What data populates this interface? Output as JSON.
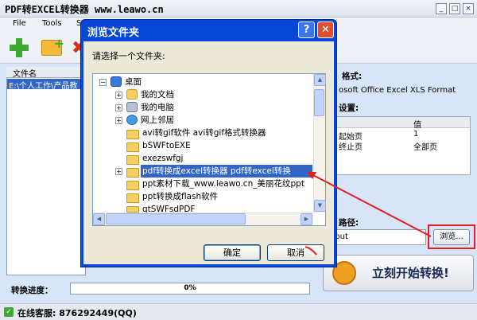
{
  "app": {
    "title": "PDF转EXCEL转换器 www.leawo.cn",
    "menu": [
      "File",
      "Tools",
      "S"
    ]
  },
  "file_list": {
    "column_header": "文件名",
    "rows": [
      "E:\\个人工作\\产品教"
    ]
  },
  "right_panel": {
    "format_label": "格式:",
    "format_value": "osoft Office Excel XLS Format",
    "settings_label": "设置:",
    "settings_header_value": "值",
    "settings_rows": [
      {
        "name": "起始页",
        "value": "1"
      },
      {
        "name": "终止页",
        "value": "全部页"
      }
    ],
    "output_label": "路径:",
    "output_value": "utput",
    "browse_label": "浏览...",
    "start_label": "立刻开始转换!"
  },
  "progress": {
    "label": "转换进度：",
    "value_text": "0%",
    "value": 0
  },
  "status": {
    "text": "在线客服: 876292449(QQ)"
  },
  "dialog": {
    "title": "浏览文件夹",
    "prompt": "请选择一个文件夹:",
    "tree": [
      {
        "label": "桌面",
        "icon": "desktop-icon"
      },
      {
        "label": "我的文档",
        "icon": "documents-icon"
      },
      {
        "label": "我的电脑",
        "icon": "computer-icon"
      },
      {
        "label": "网上邻居",
        "icon": "network-icon"
      },
      {
        "label": "avi转gif软件 avi转gif格式转换器",
        "icon": "folder-icon"
      },
      {
        "label": "bSWFtoEXE",
        "icon": "folder-icon"
      },
      {
        "label": "exezswfgj",
        "icon": "folder-icon"
      },
      {
        "label": "pdf转换成excel转换器 pdf转excel转换",
        "icon": "folder-icon",
        "selected": true
      },
      {
        "label": "ppt素材下载_www.leawo.cn_美丽花纹ppt",
        "icon": "folder-icon"
      },
      {
        "label": "ppt转换成flash软件",
        "icon": "folder-icon"
      },
      {
        "label": "qtSWFsdPDF",
        "icon": "folder-icon"
      }
    ],
    "ok_label": "确定",
    "cancel_label": "取消"
  },
  "colors": {
    "dialog_title_bar": "#0846d8",
    "selection": "#3166c8",
    "highlight_box": "#e0201c",
    "start_icon": "#f0a020"
  }
}
